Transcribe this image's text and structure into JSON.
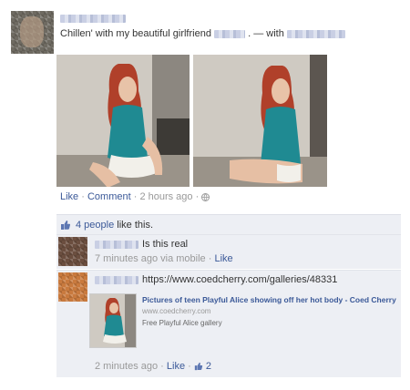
{
  "post": {
    "status_text": "Chillen' with my beautiful girlfriend",
    "with_text": ". — with",
    "actions": {
      "like": "Like",
      "comment": "Comment",
      "time": "2 hours ago"
    }
  },
  "likes_row": {
    "text_link": "4 people",
    "text_rest": "like this."
  },
  "comments": [
    {
      "text": "Is this real",
      "time": "7 minutes ago via mobile",
      "like": "Like"
    },
    {
      "url": "https://www.coedcherry.com/galleries/48331",
      "preview": {
        "title": "Pictures of teen Playful Alice showing off her hot body - Coed Cherry",
        "domain": "www.coedcherry.com",
        "description": "Free Playful Alice gallery"
      },
      "time": "2 minutes ago",
      "like": "Like",
      "like_count": "2"
    }
  ],
  "colors": {
    "link": "#3b5998",
    "panel_bg": "#edeff4",
    "grey_text": "#999999"
  },
  "icons": [
    "thumbs-up-icon",
    "globe-icon"
  ]
}
